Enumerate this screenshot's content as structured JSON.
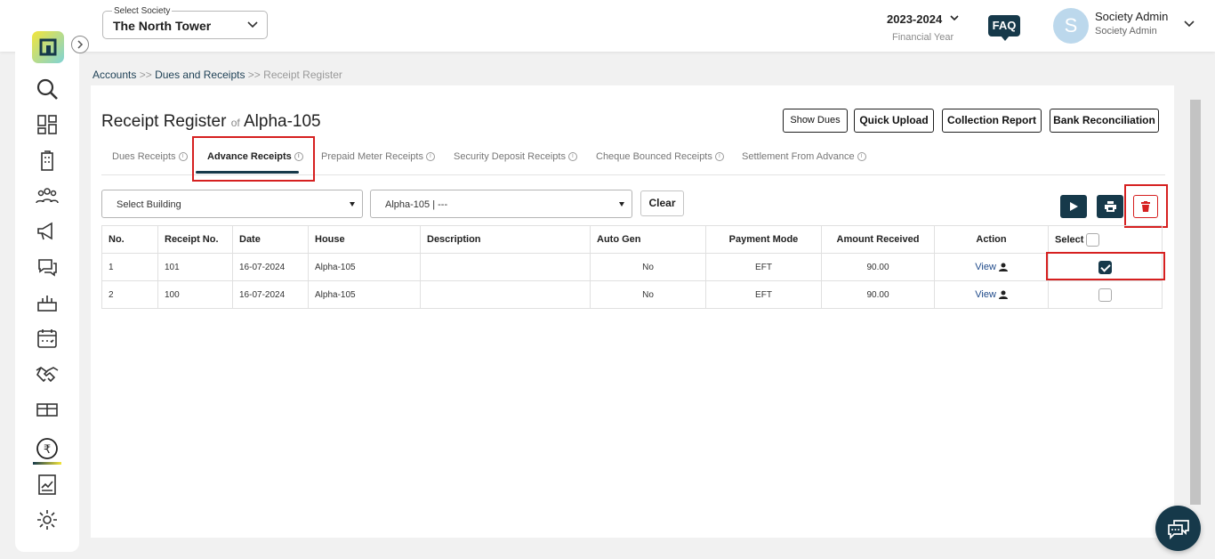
{
  "header": {
    "society_label": "Select Society",
    "society_value": "The North Tower",
    "fy_year": "2023-2024",
    "fy_label": "Financial Year",
    "faq": "FAQ",
    "avatar_initial": "S",
    "user_name": "Society Admin",
    "user_role": "Society Admin"
  },
  "sidebar": {
    "items": [
      "search-icon",
      "dashboard-icon",
      "building-icon",
      "members-icon",
      "announcement-icon",
      "chat-icon",
      "amenity-icon",
      "calendar-icon",
      "handshake-icon",
      "parcel-icon",
      "rupee-icon",
      "report-icon",
      "settings-icon"
    ],
    "active": "rupee-icon"
  },
  "breadcrumb": {
    "item1": "Accounts",
    "sep": ">>",
    "item2": "Dues and Receipts",
    "item3": "Receipt Register"
  },
  "page": {
    "title": "Receipt Register",
    "of": "of",
    "unit": "Alpha-105"
  },
  "buttons": {
    "show_dues": "Show Dues",
    "quick_upload": "Quick Upload",
    "collection_report": "Collection Report",
    "bank_reconciliation": "Bank Reconciliation",
    "clear": "Clear"
  },
  "tabs": [
    {
      "label": "Dues Receipts",
      "active": false
    },
    {
      "label": "Advance Receipts",
      "active": true
    },
    {
      "label": "Prepaid Meter Receipts",
      "active": false
    },
    {
      "label": "Security Deposit Receipts",
      "active": false
    },
    {
      "label": "Cheque Bounced Receipts",
      "active": false
    },
    {
      "label": "Settlement From Advance",
      "active": false
    }
  ],
  "filters": {
    "building_placeholder": "Select Building",
    "unit_value": "Alpha-105 | ---"
  },
  "table": {
    "headers": [
      "No.",
      "Receipt No.",
      "Date",
      "House",
      "Description",
      "Auto Gen",
      "Payment Mode",
      "Amount Received",
      "Action",
      "Select"
    ],
    "rows": [
      {
        "no": "1",
        "receipt": "101",
        "date": "16-07-2024",
        "house": "Alpha-105",
        "description": "",
        "auto_gen": "No",
        "mode": "EFT",
        "amount": "90.00",
        "action": "View",
        "selected": true
      },
      {
        "no": "2",
        "receipt": "100",
        "date": "16-07-2024",
        "house": "Alpha-105",
        "description": "",
        "auto_gen": "No",
        "mode": "EFT",
        "amount": "90.00",
        "action": "View",
        "selected": false
      }
    ]
  },
  "colors": {
    "primary": "#16394a",
    "highlight": "#d62020"
  }
}
